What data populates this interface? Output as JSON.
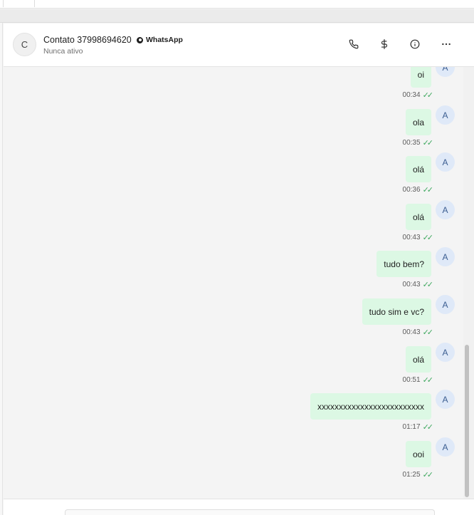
{
  "header": {
    "avatar_initial": "C",
    "contact_name": "Contato 37998694620",
    "channel": "WhatsApp",
    "status": "Nunca ativo",
    "actions": {
      "call_icon": "phone-icon",
      "payment_icon": "dollar-icon",
      "info_icon": "info-icon",
      "more_icon": "more-icon"
    }
  },
  "messages": [
    {
      "text": "oi",
      "time": "00:34",
      "sender": "A"
    },
    {
      "text": "ola",
      "time": "00:35",
      "sender": "A"
    },
    {
      "text": "olá",
      "time": "00:36",
      "sender": "A"
    },
    {
      "text": "olá",
      "time": "00:43",
      "sender": "A"
    },
    {
      "text": "tudo bem?",
      "time": "00:43",
      "sender": "A"
    },
    {
      "text": "tudo sim e vc?",
      "time": "00:43",
      "sender": "A"
    },
    {
      "text": "olá",
      "time": "00:51",
      "sender": "A"
    },
    {
      "text": "xxxxxxxxxxxxxxxxxxxxxxxxx",
      "time": "01:17",
      "sender": "A"
    },
    {
      "text": "ooi",
      "time": "01:25",
      "sender": "A"
    }
  ],
  "read_ticks": "✓✓",
  "colors": {
    "bubble": "#dcf8e4",
    "tick": "#3fa85f",
    "sender_avatar": "#dfe9f8"
  }
}
